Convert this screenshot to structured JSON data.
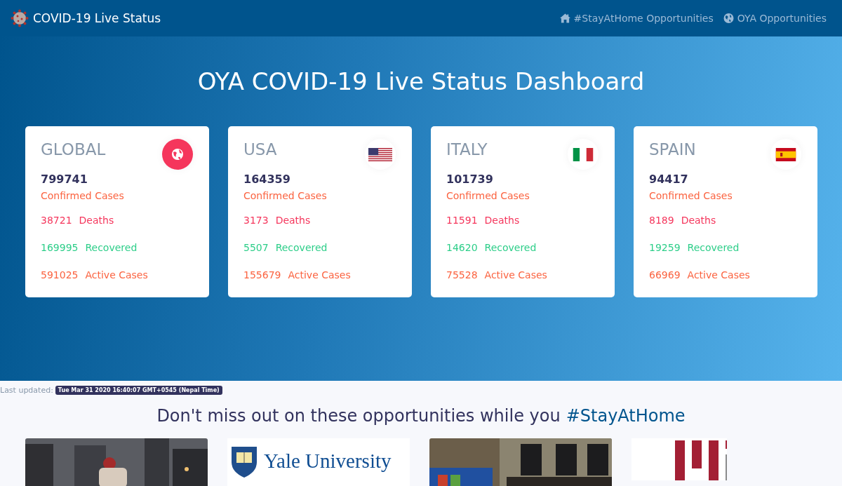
{
  "navbar": {
    "brand": "COVID-19 Live Status",
    "links": [
      {
        "kind": "home",
        "label": "#StayAtHome Opportunities"
      },
      {
        "kind": "globe",
        "label": "OYA Opportunities"
      }
    ]
  },
  "hero": {
    "title": "OYA COVID-19 Live Status Dashboard",
    "cards": [
      {
        "name": "GLOBAL",
        "kind": "globe",
        "confirmed": "799741",
        "confirmed_label": "Confirmed Cases",
        "stats": [
          {
            "kind": "deaths",
            "value": "38721",
            "label": "Deaths"
          },
          {
            "kind": "recovered",
            "value": "169995",
            "label": "Recovered"
          },
          {
            "kind": "active",
            "value": "591025",
            "label": "Active Cases"
          }
        ]
      },
      {
        "name": "USA",
        "kind": "us",
        "confirmed": "164359",
        "confirmed_label": "Confirmed Cases",
        "stats": [
          {
            "kind": "deaths",
            "value": "3173",
            "label": "Deaths"
          },
          {
            "kind": "recovered",
            "value": "5507",
            "label": "Recovered"
          },
          {
            "kind": "active",
            "value": "155679",
            "label": "Active Cases"
          }
        ]
      },
      {
        "name": "ITALY",
        "kind": "it",
        "confirmed": "101739",
        "confirmed_label": "Confirmed Cases",
        "stats": [
          {
            "kind": "deaths",
            "value": "11591",
            "label": "Deaths"
          },
          {
            "kind": "recovered",
            "value": "14620",
            "label": "Recovered"
          },
          {
            "kind": "active",
            "value": "75528",
            "label": "Active Cases"
          }
        ]
      },
      {
        "name": "SPAIN",
        "kind": "es",
        "confirmed": "94417",
        "confirmed_label": "Confirmed Cases",
        "stats": [
          {
            "kind": "deaths",
            "value": "8189",
            "label": "Deaths"
          },
          {
            "kind": "recovered",
            "value": "19259",
            "label": "Recovered"
          },
          {
            "kind": "active",
            "value": "66969",
            "label": "Active Cases"
          }
        ]
      }
    ]
  },
  "last_updated": {
    "label": "Last updated:",
    "time": "Tue Mar 31 2020 16:40:07 GMT+0545 (Nepal Time)"
  },
  "opportunities": {
    "heading": "Don't miss out on these opportunities while you",
    "highlight": "#StayAtHome",
    "tiles": [
      {
        "kind": "picture"
      },
      {
        "kind": "yale",
        "text": "Yale University"
      },
      {
        "kind": "picture"
      },
      {
        "kind": "mit"
      }
    ]
  }
}
